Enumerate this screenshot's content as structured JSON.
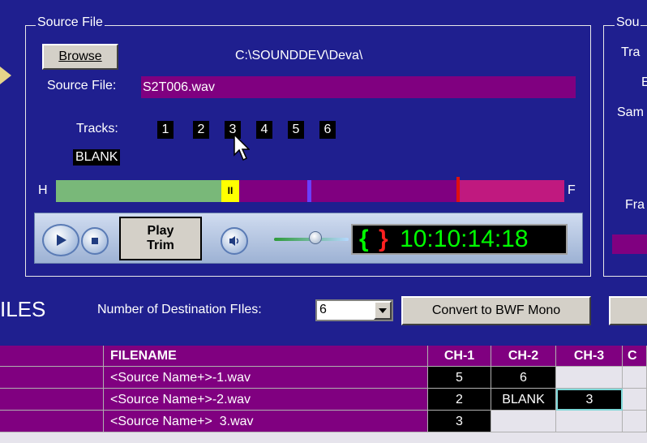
{
  "source_group": {
    "legend": "Source File",
    "browse_label": "Browse",
    "path": "C:\\SOUNDDEV\\Deva\\",
    "source_file_label": "Source File:",
    "source_file_value": "S2T006.wav",
    "tracks_label": "Tracks:",
    "tracks": [
      "1",
      "2",
      "3",
      "4",
      "5",
      "6"
    ],
    "blank_label": "BLANK",
    "h_label": "H",
    "f_label": "F",
    "play_trim_line1": "Play",
    "play_trim_line2": "Trim",
    "brace_open": "{",
    "brace_close": "}",
    "timecode": "10:10:14:18",
    "marker_label": "II"
  },
  "right_group": {
    "legend": "Sou",
    "labels": [
      "Tra",
      "E",
      "Sam",
      "Fra"
    ]
  },
  "destination": {
    "section_title": "ILES",
    "count_label": "Number of Destination FIles:",
    "count_value": "6",
    "convert_label": "Convert to BWF Mono"
  },
  "table": {
    "headers": [
      "FILENAME",
      "CH-1",
      "CH-2",
      "CH-3",
      "C"
    ],
    "rows": [
      {
        "filename": "<Source Name+>-1.wav",
        "ch1": "5",
        "ch2": "6",
        "ch3": ""
      },
      {
        "filename": "<Source Name+>-2.wav",
        "ch1": "2",
        "ch2": "BLANK",
        "ch3": "3"
      },
      {
        "filename": "<Source Name+>  3.wav",
        "ch1": "3",
        "ch2": "",
        "ch3": ""
      }
    ]
  },
  "colors": {
    "background": "#1f1f8f",
    "purple": "#800080",
    "green_bar": "#79b879",
    "magenta": "#c0197f",
    "timecode_green": "#00ff00"
  }
}
